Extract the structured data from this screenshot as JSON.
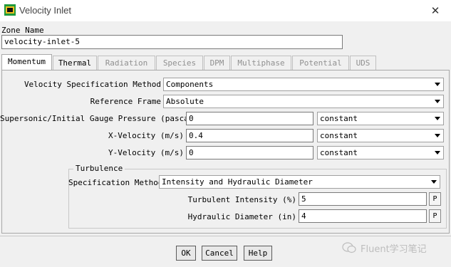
{
  "window": {
    "title": "Velocity Inlet",
    "close_glyph": "✕"
  },
  "zone": {
    "label": "Zone Name",
    "value": "velocity-inlet-5"
  },
  "tabs": [
    {
      "label": "Momentum",
      "active": true,
      "enabled": true
    },
    {
      "label": "Thermal",
      "active": false,
      "enabled": true
    },
    {
      "label": "Radiation",
      "active": false,
      "enabled": false
    },
    {
      "label": "Species",
      "active": false,
      "enabled": false
    },
    {
      "label": "DPM",
      "active": false,
      "enabled": false
    },
    {
      "label": "Multiphase",
      "active": false,
      "enabled": false
    },
    {
      "label": "Potential",
      "active": false,
      "enabled": false
    },
    {
      "label": "UDS",
      "active": false,
      "enabled": false
    }
  ],
  "momentum": {
    "velocity_spec_label": "Velocity Specification Method",
    "velocity_spec_value": "Components",
    "reference_frame_label": "Reference Frame",
    "reference_frame_value": "Absolute",
    "pressure_label": "Supersonic/Initial Gauge Pressure (pascal)",
    "pressure_value": "0",
    "pressure_method": "constant",
    "x_velocity_label": "X-Velocity (m/s)",
    "x_velocity_value": "0.4",
    "x_velocity_method": "constant",
    "y_velocity_label": "Y-Velocity (m/s)",
    "y_velocity_value": "0",
    "y_velocity_method": "constant"
  },
  "turbulence": {
    "group_label": "Turbulence",
    "spec_method_label": "Specification Method",
    "spec_method_value": "Intensity and Hydraulic Diameter",
    "intensity_label": "Turbulent Intensity (%)",
    "intensity_value": "5",
    "diameter_label": "Hydraulic Diameter (in)",
    "diameter_value": "4",
    "p_label": "P"
  },
  "buttons": {
    "ok": "OK",
    "cancel": "Cancel",
    "help": "Help"
  },
  "watermark": {
    "text": "Fluent学习笔记"
  },
  "colors": {
    "icon_green": "#1f9a3c",
    "icon_yellow": "#f0c020"
  }
}
